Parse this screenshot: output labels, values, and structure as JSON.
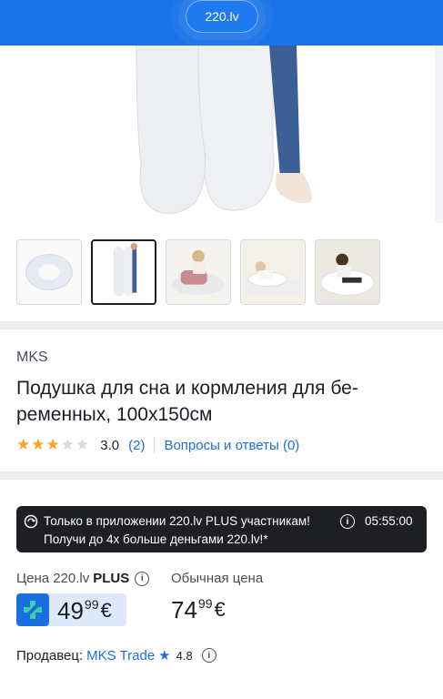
{
  "header": {
    "logo_text": "220.lv",
    "bg_color": "#1a73e8"
  },
  "gallery": {
    "thumbnails": [
      {
        "name": "thumb-1",
        "active": false
      },
      {
        "name": "thumb-2",
        "active": true
      },
      {
        "name": "thumb-3",
        "active": false
      },
      {
        "name": "thumb-4",
        "active": false
      },
      {
        "name": "thumb-5",
        "active": false
      }
    ]
  },
  "product": {
    "brand": "MKS",
    "title": "Подушка для сна и кормления для бе-ременных, 100x150см",
    "title_line1": "Подушка для сна и кормления для бе-",
    "title_line2": "ременных, 100x150см",
    "rating": 3,
    "rating_max": 5,
    "rating_text": "3.0",
    "reviews_text": "(2)",
    "qa_text": "Вопросы и ответы (0)"
  },
  "promo": {
    "line1": "Только в приложении 220.lv PLUS участникам!",
    "line2": "Получи до 4x больше деньгами 220.lv!*",
    "timer": "05:55:00",
    "info_icon": "i"
  },
  "pricing": {
    "plus_label_prefix": "Цена 220.lv",
    "plus_label_bold": "PLUS",
    "plus_price_main": "49",
    "plus_price_cents": "99",
    "currency": "€",
    "regular_label": "Обычная цена",
    "regular_price_main": "74",
    "regular_price_cents": "99"
  },
  "seller": {
    "label": "Продавец:",
    "name": "MKS Trade",
    "rating": "4.8"
  },
  "colors": {
    "accent": "#1a6fe0",
    "star": "#f5a623",
    "promo_bg": "#1d1f23"
  }
}
